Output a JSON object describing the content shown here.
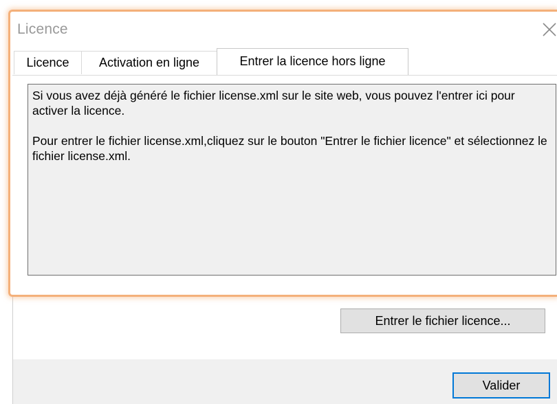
{
  "window": {
    "title": "Licence"
  },
  "tabs": [
    {
      "label": "Licence",
      "active": false
    },
    {
      "label": "Activation en ligne",
      "active": false
    },
    {
      "label": "Entrer la licence hors ligne",
      "active": true
    }
  ],
  "panel": {
    "paragraph1": "Si vous avez déjà généré le fichier license.xml sur le site web, vous pouvez l'entrer ici pour activer la licence.",
    "paragraph2": "Pour entrer le fichier license.xml,cliquez sur le bouton  \"Entrer le fichier licence\" et sélectionnez le fichier license.xml."
  },
  "buttons": {
    "enter_file": "Entrer le fichier licence...",
    "validate": "Valider"
  },
  "colors": {
    "highlight": "#f4b07a",
    "default_button_border": "#0078d7",
    "info_background": "#f0f0f0"
  }
}
